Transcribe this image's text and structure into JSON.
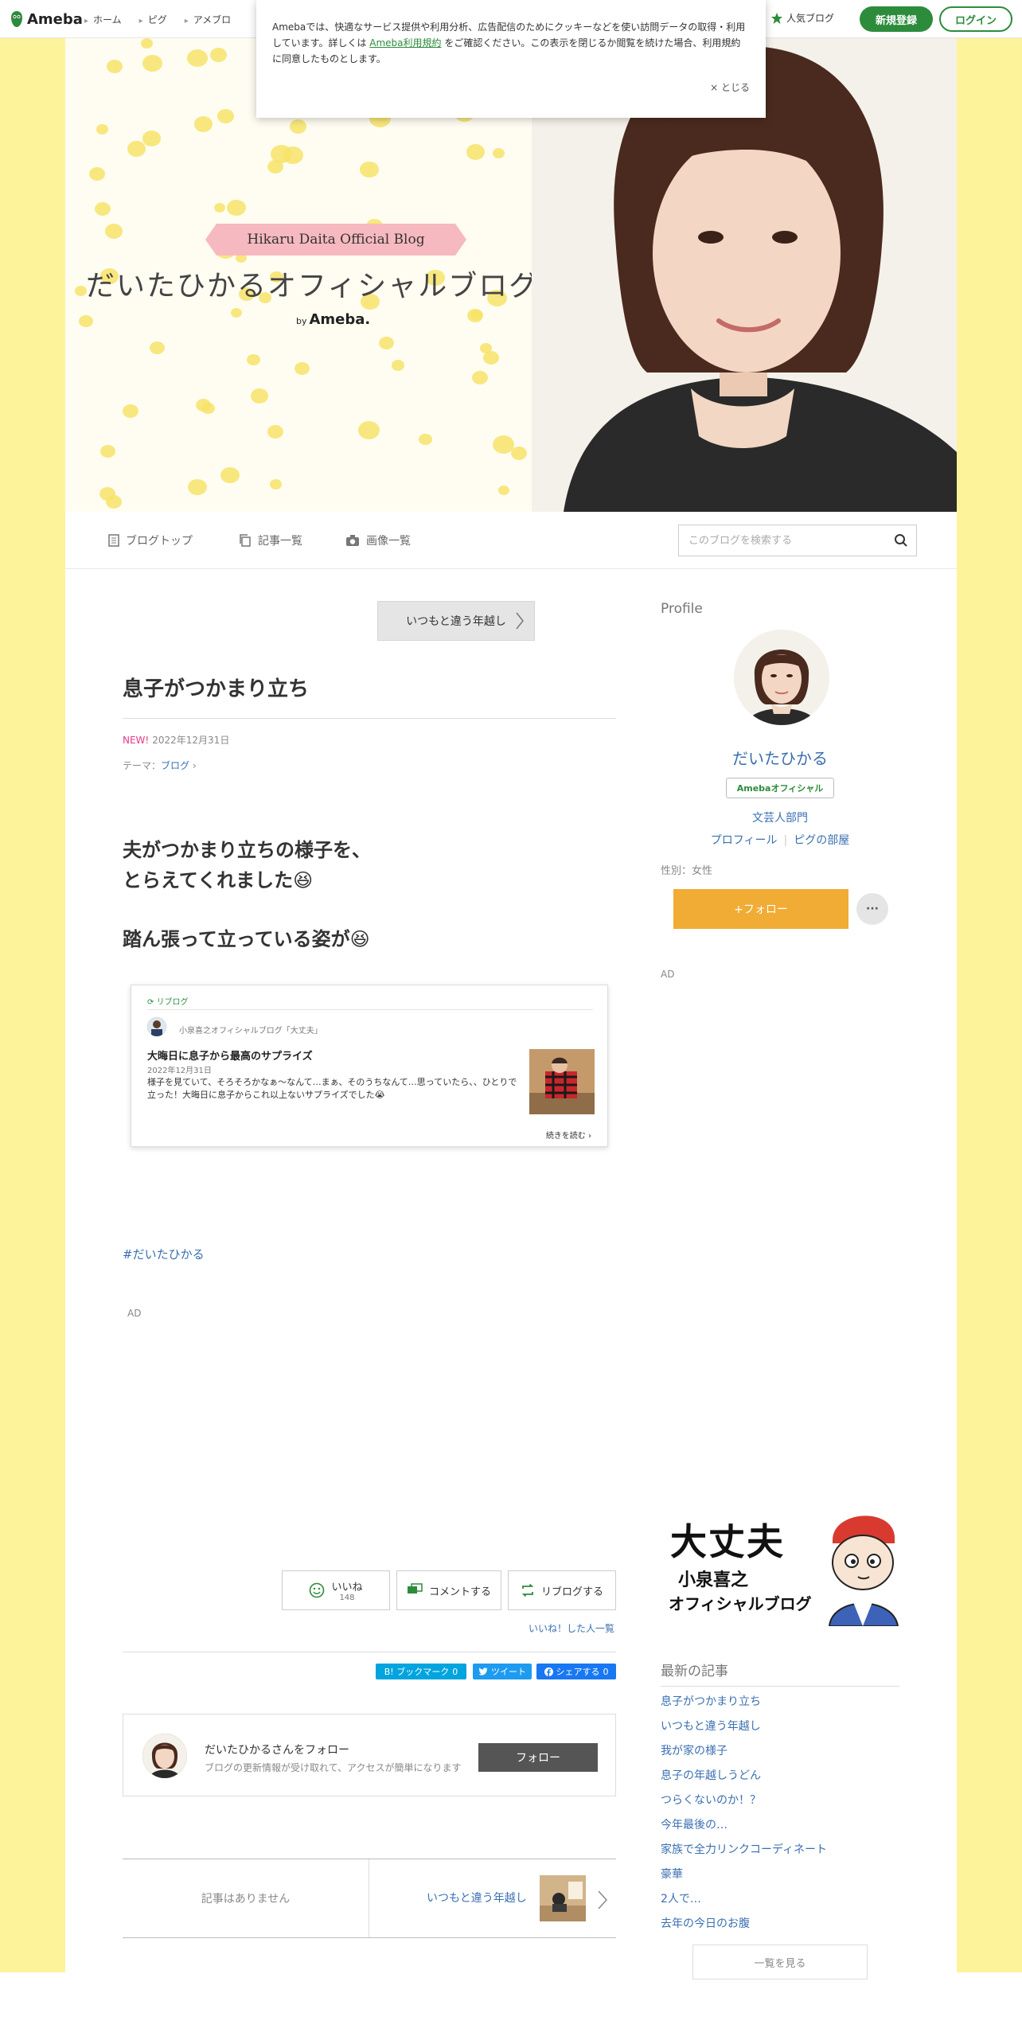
{
  "topbar": {
    "logo": "Ameba",
    "nav": [
      "ホーム",
      "ピグ",
      "アメブロ"
    ],
    "popular": "人気ブログ",
    "signup": "新規登録",
    "login": "ログイン"
  },
  "cookie": {
    "text_before": "Amebaでは、快適なサービス提供や利用分析、広告配信のためにクッキーなどを使い訪問データの取得・利用しています。詳しくは ",
    "link": "Ameba利用規約",
    "text_after": " をご確認ください。この表示を閉じるか閲覧を続けた場合、利用規約に同意したものとします。",
    "close": "× とじる"
  },
  "header": {
    "ribbon": "Hikaru Daita Official Blog",
    "title": "だいたひかるオフィシャルブログ",
    "by": "by",
    "brand": "Ameba."
  },
  "tabs": {
    "top": "ブログトップ",
    "list": "記事一覧",
    "images": "画像一覧",
    "search_placeholder": "このブログを検索する"
  },
  "article": {
    "prev_label": "いつもと違う年越し",
    "title": "息子がつかまり立ち",
    "new": "NEW!",
    "date": "2022年12月31日",
    "theme_label": "テーマ：",
    "theme": "ブログ",
    "body_line1": "夫がつかまり立ちの様子を、",
    "body_line2": "とらえてくれました😆",
    "body_line3": "踏ん張って立っている姿が😆",
    "hashtag": "#だいたひかる",
    "ad": "AD"
  },
  "reblog": {
    "label": "リブログ",
    "source": "小泉喜之オフィシャルブログ「大丈夫」",
    "title": "大晦日に息子から最高のサプライズ",
    "date": "2022年12月31日",
    "text": "様子を見ていて、そろそろかなぁ〜なんて…まぁ、そのうちなんて…思っていたら、、ひとりで立った！大晦日に息子からこれ以上ないサプライズでした😭",
    "more": "続きを読む"
  },
  "reactions": {
    "like": "いいね",
    "like_count": "148",
    "comment": "コメントする",
    "reblog": "リブログする",
    "liked_list": "いいね！した人一覧"
  },
  "share": {
    "hatena": "B! ブックマーク",
    "hatena_count": "0",
    "tweet": "ツイート",
    "facebook": "シェアする",
    "facebook_count": "0"
  },
  "follow_box": {
    "title": "だいたひかるさんをフォロー",
    "sub": "ブログの更新情報が受け取れて、アクセスが簡単になります",
    "button": "フォロー"
  },
  "pager": {
    "none": "記事はありません",
    "next": "いつもと違う年越し"
  },
  "sidebar": {
    "profile_heading": "Profile",
    "name": "だいたひかる",
    "badge": "Amebaオフィシャル",
    "category": "文芸人部門",
    "profile_link": "プロフィール",
    "pig_link": "ピグの部屋",
    "gender": "性別：女性",
    "follow": "+フォロー",
    "more": "···",
    "ad": "AD",
    "banner_line1": "大丈夫",
    "banner_line2": "小泉喜之",
    "banner_line3": "オフィシャルブログ",
    "latest_heading": "最新の記事",
    "latest": [
      "息子がつかまり立ち",
      "いつもと違う年越し",
      "我が家の様子",
      "息子の年越しうどん",
      "つらくないのか！？",
      "今年最後の…",
      "家族で全力リンクコーディネート",
      "豪華",
      "2人で…",
      "去年の今日のお腹"
    ],
    "see_all": "一覧を見る"
  },
  "colors": {
    "accent_green": "#2d8c3c",
    "link_blue": "#3a6fb0",
    "follow_orange": "#f0ac34",
    "side_yellow": "#fdf39b"
  }
}
